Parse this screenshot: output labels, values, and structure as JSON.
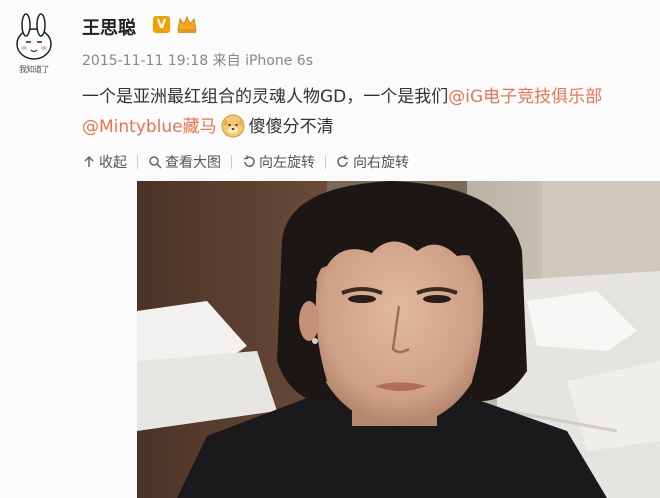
{
  "avatar": {
    "caption": "我知道了",
    "icon": "rabbit-avatar-icon"
  },
  "user": {
    "name": "王思聪",
    "verified_badge": "V"
  },
  "post": {
    "timestamp": "2015-11-11 19:18",
    "source_prefix": "来自",
    "source": "iPhone 6s",
    "line1_text": "一个是亚洲最红组合的灵魂人物GD，一个是我们",
    "line1_mention": "@iG电子竞技俱乐部",
    "line2_mention": "@Mintyblue藏马",
    "line2_text": "傻傻分不清"
  },
  "toolbar": {
    "collapse": "收起",
    "view_large": "查看大图",
    "rotate_left": "向左旋转",
    "rotate_right": "向右旋转"
  },
  "colors": {
    "mention": "#eb7350",
    "badge": "#f0a000",
    "meta": "#888888"
  }
}
